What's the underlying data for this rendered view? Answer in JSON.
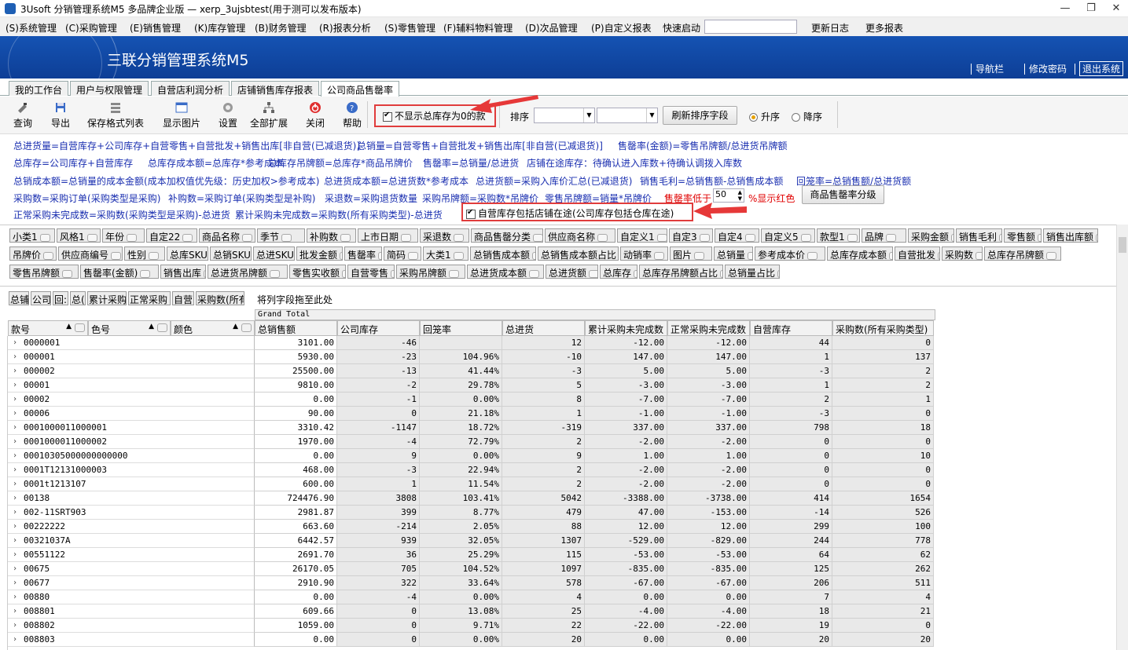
{
  "window": {
    "title": "3Usoft 分销管理系统M5 多品牌企业版 — xerp_3ujsbtest(用于测可以发布版本)",
    "minimize": "—",
    "restore": "❐",
    "close": "✕"
  },
  "menu": {
    "items": [
      "(S)系统管理",
      "(C)采购管理",
      "(E)销售管理",
      "(K)库存管理",
      "(B)财务管理",
      "(R)报表分析",
      "(S)零售管理",
      "(F)辅料物料管理",
      "(D)次品管理",
      "(P)自定义报表"
    ],
    "quick_label": "快速启动",
    "changelog": "更新日志",
    "more_reports": "更多报表"
  },
  "banner": {
    "system_name": "三联分销管理系统M5",
    "nav_bar": "导航栏",
    "change_password": "修改密码",
    "exit_system": "退出系统"
  },
  "tabs": [
    "我的工作台",
    "用户与权限管理",
    "自营店利润分析",
    "店铺销售库存报表",
    "公司商品售罄率"
  ],
  "toolbar": {
    "query": "查询",
    "export": "导出",
    "save_format": "保存格式列表",
    "show_image": "显示图片",
    "settings": "设置",
    "expand_all": "全部扩展",
    "close": "关闭",
    "help": "帮助",
    "hide_zero_stock": "不显示总库存为0的款",
    "sort_label": "排序",
    "refresh_sort": "刷新排序字段",
    "ascending": "升序",
    "descending": "降序"
  },
  "formulas": {
    "l1a": "总进货量=自营库存+公司库存+自营零售+自营批发+销售出库[非自营(已减退货)]",
    "l1b": "总销量=自营零售+自营批发+销售出库[非自营(已减退货)]",
    "l1c": "售罄率(金额)=零售吊牌额/总进货吊牌额",
    "l2a": "总库存=公司库存+自营库存",
    "l2b": "总库存成本额=总库存*参考成本",
    "l2c": "总库存吊牌额=总库存*商品吊牌价",
    "l2d": "售罄率=总销量/总进货",
    "l2e": "店铺在途库存：待确认进入库数+待确认调拨入库数",
    "l3a": "总销成本额=总销量的成本金额(成本加权值优先级：历史加权>参考成本)",
    "l3b": "总进货成本额=总进货数*参考成本",
    "l3c": "总进货额=采购入库价汇总(已减退货)",
    "l3d": "销售毛利=总销售额-总销售成本额",
    "l3e": "回笼率=总销售额/总进货额",
    "l4a": "采购数=采购订单(采购类型是采购)",
    "l4b": "补购数=采购订单(采购类型是补购)",
    "l4c": "采退数=采购退货数量",
    "l4d": "采购吊牌额=采购数*吊牌价",
    "l4e": "零售吊牌额=销量*吊牌价",
    "l4f": "售罄率低于",
    "l4g": "50",
    "l4h": "%显示红色",
    "l4i": "商品售罄率分级",
    "l5a": "正常采购未完成数=采购数(采购类型是采购)-总进货",
    "l5b": "累计采购未完成数=采购数(所有采购类型)-总进货",
    "l5c": "自营库存包括店铺在途(公司库存包括仓库在途)"
  },
  "fields": {
    "row1": [
      "小类1",
      "风格1",
      "年份",
      "自定22",
      "商品名称",
      "季节",
      "补购数",
      "上市日期",
      "采退数",
      "商品售罄分类",
      "供应商名称",
      "自定义1",
      "自定3",
      "自定4",
      "自定义5",
      "款型1",
      "品牌",
      "采购金额",
      "销售毛利",
      "零售额",
      "销售出库额"
    ],
    "row2": [
      "吊牌价",
      "供应商编号",
      "性别",
      "总库SKU",
      "总销SKU",
      "总进SKU",
      "批发金额",
      "售罄率",
      "简码",
      "大类1",
      "总销售成本额",
      "总销售成本额占比",
      "动销率",
      "图片",
      "总销量",
      "参考成本价",
      "总库存成本额",
      "自营批发",
      "采购数",
      "总库存吊牌额"
    ],
    "row3": [
      "零售吊牌额",
      "售罄率(金额)",
      "销售出库",
      "总进货吊牌额",
      "零售实收额",
      "自营零售",
      "采购吊牌额",
      "总进货成本额",
      "总进货额",
      "总库存",
      "总库存吊牌额占比",
      "总销量占比"
    ]
  },
  "column_fields": [
    "总铺",
    "公司",
    "回:",
    "总(",
    "累计采购",
    "正常采购",
    "自营",
    "采购数(所有"
  ],
  "column_drop_hint": "将列字段拖至此处",
  "grid": {
    "grand_total": "Grand Total",
    "row_headers": [
      "款号",
      "色号",
      "颜色"
    ],
    "columns": [
      "总销售额",
      "公司库存",
      "回笼率",
      "总进货",
      "累计采购未完成数",
      "正常采购未完成数",
      "自营库存",
      "采购数(所有采购类型)"
    ],
    "rows": [
      [
        "0000001",
        "3101.00",
        "-46",
        "",
        "12",
        "-12.00",
        "-12.00",
        "44",
        "0"
      ],
      [
        "000001",
        "5930.00",
        "-23",
        "104.96%",
        "-10",
        "147.00",
        "147.00",
        "1",
        "137"
      ],
      [
        "000002",
        "25500.00",
        "-13",
        "41.44%",
        "-3",
        "5.00",
        "5.00",
        "-3",
        "2"
      ],
      [
        "00001",
        "9810.00",
        "-2",
        "29.78%",
        "5",
        "-3.00",
        "-3.00",
        "1",
        "2"
      ],
      [
        "00002",
        "0.00",
        "-1",
        "0.00%",
        "8",
        "-7.00",
        "-7.00",
        "2",
        "1"
      ],
      [
        "00006",
        "90.00",
        "0",
        "21.18%",
        "1",
        "-1.00",
        "-1.00",
        "-3",
        "0"
      ],
      [
        "0001000011000001",
        "3310.42",
        "-1147",
        "18.72%",
        "-319",
        "337.00",
        "337.00",
        "798",
        "18"
      ],
      [
        "0001000011000002",
        "1970.00",
        "-4",
        "72.79%",
        "2",
        "-2.00",
        "-2.00",
        "0",
        "0"
      ],
      [
        "00010305000000000000",
        "0.00",
        "9",
        "0.00%",
        "9",
        "1.00",
        "1.00",
        "0",
        "10"
      ],
      [
        "0001T12131000003",
        "468.00",
        "-3",
        "22.94%",
        "2",
        "-2.00",
        "-2.00",
        "0",
        "0"
      ],
      [
        "0001t1213107",
        "600.00",
        "1",
        "11.54%",
        "2",
        "-2.00",
        "-2.00",
        "0",
        "0"
      ],
      [
        "00138",
        "724476.90",
        "3808",
        "103.41%",
        "5042",
        "-3388.00",
        "-3738.00",
        "414",
        "1654"
      ],
      [
        "002-11SRT903",
        "2981.87",
        "399",
        "8.77%",
        "479",
        "47.00",
        "-153.00",
        "-14",
        "526"
      ],
      [
        "00222222",
        "663.60",
        "-214",
        "2.05%",
        "88",
        "12.00",
        "12.00",
        "299",
        "100"
      ],
      [
        "00321037A",
        "6442.57",
        "939",
        "32.05%",
        "1307",
        "-529.00",
        "-829.00",
        "244",
        "778"
      ],
      [
        "00551122",
        "2691.70",
        "36",
        "25.29%",
        "115",
        "-53.00",
        "-53.00",
        "64",
        "62"
      ],
      [
        "00675",
        "26170.05",
        "705",
        "104.52%",
        "1097",
        "-835.00",
        "-835.00",
        "125",
        "262"
      ],
      [
        "00677",
        "2910.90",
        "322",
        "33.64%",
        "578",
        "-67.00",
        "-67.00",
        "206",
        "511"
      ],
      [
        "00880",
        "0.00",
        "-4",
        "0.00%",
        "4",
        "0.00",
        "0.00",
        "7",
        "4"
      ],
      [
        "008801",
        "609.66",
        "0",
        "13.08%",
        "25",
        "-4.00",
        "-4.00",
        "18",
        "21"
      ],
      [
        "008802",
        "1059.00",
        "0",
        "9.71%",
        "22",
        "-22.00",
        "-22.00",
        "19",
        "0"
      ],
      [
        "008803",
        "0.00",
        "0",
        "0.00%",
        "20",
        "0.00",
        "0.00",
        "20",
        "20"
      ]
    ]
  }
}
